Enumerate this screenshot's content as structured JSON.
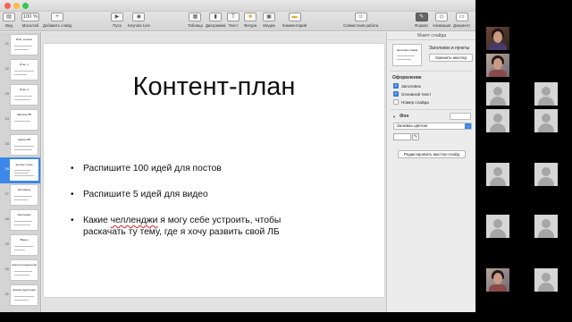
{
  "toolbar": {
    "view": "Вид",
    "zoom_value": "100 %",
    "zoom_label": "Масштаб",
    "add_slide": "Добавить слайд",
    "play": "Пуск",
    "keynote_live": "Keynote Live",
    "table": "Таблица",
    "chart": "Диаграмма",
    "text": "Текст",
    "shape": "Фигура",
    "media": "Медиа",
    "comment": "Комментарий",
    "collaborate": "Совместная работа",
    "format": "Формат",
    "animate": "Анимация",
    "document": "Документ"
  },
  "navigator": {
    "slides": [
      {
        "num": "21",
        "title": "Итак, хочешь"
      },
      {
        "num": "22",
        "title": "Итак, 1"
      },
      {
        "num": "23",
        "title": "Итак, 2"
      },
      {
        "num": "24",
        "title": "Записка ЛБ"
      },
      {
        "num": "25",
        "title": "Анкета ЛБ"
      },
      {
        "num": "26",
        "title": "Контент-план"
      },
      {
        "num": "27",
        "title": "Интервью"
      },
      {
        "num": "28",
        "title": "Инстаграм"
      },
      {
        "num": "29",
        "title": "Видео"
      },
      {
        "num": "30",
        "title": "Анализ конкурентов"
      },
      {
        "num": "31",
        "title": "Анализ аудитории"
      }
    ]
  },
  "slide": {
    "title": "Контент-план",
    "bullets": [
      "Распишите 100 идей для постов",
      "Распишите 5 идей для видео"
    ],
    "bullet3_pre": "Какие ",
    "bullet3_mark": "челленджи",
    "bullet3_post": " я могу себе устроить, чтобы",
    "bullet3_line2": "раскачать ту тему, где я хочу развить свой ЛБ"
  },
  "inspector": {
    "header": "Макет слайда",
    "master_thumb_title": "Заголовок слайда",
    "master_name": "Заголовок и пункты",
    "change_master": "Сменить мастер",
    "appearance_title": "Оформление",
    "checkboxes": [
      {
        "label": "Заголовок",
        "checked": true
      },
      {
        "label": "Основной текст",
        "checked": true
      },
      {
        "label": "Номер слайда",
        "checked": false
      }
    ],
    "background_title": "Фон",
    "fill_value": "Заливка цветом",
    "edit_master": "Редактировать мастер-слайд"
  },
  "colors": {
    "accent": "#3b88e8",
    "slide_bg": "#ffffff",
    "sidebar_bg": "#d4d4d4"
  }
}
